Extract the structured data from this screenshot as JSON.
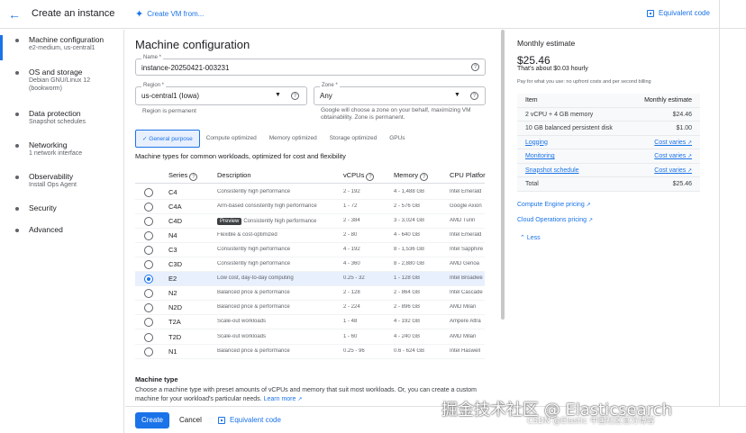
{
  "header": {
    "title": "Create an instance",
    "create_vm_from": "Create VM from...",
    "equivalent_code": "Equivalent code"
  },
  "nav": [
    {
      "label": "Machine configuration",
      "sub": "e2-medium, us-central1",
      "active": true
    },
    {
      "label": "OS and storage",
      "sub": "Debian GNU/Linux 12 (bookworm)"
    },
    {
      "label": "Data protection",
      "sub": "Snapshot schedules"
    },
    {
      "label": "Networking",
      "sub": "1 network interface"
    },
    {
      "label": "Observability",
      "sub": "Install Ops Agent"
    },
    {
      "label": "Security",
      "sub": ""
    },
    {
      "label": "Advanced",
      "sub": ""
    }
  ],
  "main": {
    "title": "Machine configuration",
    "name_label": "Name *",
    "name_value": "instance-20250421-003231",
    "region_label": "Region *",
    "region_value": "us-central1 (Iowa)",
    "region_hint": "Region is permanent",
    "zone_label": "Zone *",
    "zone_value": "Any",
    "zone_hint": "Google will choose a zone on your behalf, maximizing VM obtainability. Zone is permanent.",
    "tabs": [
      "General purpose",
      "Compute optimized",
      "Memory optimized",
      "Storage optimized",
      "GPUs"
    ],
    "machine_types_title": "Machine types for common workloads, optimized for cost and flexibility",
    "columns": [
      "Series",
      "Description",
      "vCPUs",
      "Memory",
      "CPU Platfor"
    ],
    "rows": [
      {
        "series": "C4",
        "desc": "Consistently high performance",
        "vcpus": "2 - 192",
        "memory": "4 - 1,488 GB",
        "platform": "Intel Emerald"
      },
      {
        "series": "C4A",
        "desc": "Arm-based consistently high performance",
        "vcpus": "1 - 72",
        "memory": "2 - 576 GB",
        "platform": "Google Axion"
      },
      {
        "series": "C4D",
        "desc": "Consistently high performance",
        "preview": "Preview",
        "vcpus": "2 - 384",
        "memory": "3 - 3,024 GB",
        "platform": "AMD Turin"
      },
      {
        "series": "N4",
        "desc": "Flexible & cost-optimized",
        "vcpus": "2 - 80",
        "memory": "4 - 640 GB",
        "platform": "Intel Emerald"
      },
      {
        "series": "C3",
        "desc": "Consistently high performance",
        "vcpus": "4 - 192",
        "memory": "8 - 1,536 GB",
        "platform": "Intel Sapphire"
      },
      {
        "series": "C3D",
        "desc": "Consistently high performance",
        "vcpus": "4 - 360",
        "memory": "8 - 2,880 GB",
        "platform": "AMD Genoa"
      },
      {
        "series": "E2",
        "desc": "Low cost, day-to-day computing",
        "vcpus": "0.25 - 32",
        "memory": "1 - 128 GB",
        "platform": "Intel Broadwe",
        "selected": true
      },
      {
        "series": "N2",
        "desc": "Balanced price & performance",
        "vcpus": "2 - 128",
        "memory": "2 - 864 GB",
        "platform": "Intel Cascade"
      },
      {
        "series": "N2D",
        "desc": "Balanced price & performance",
        "vcpus": "2 - 224",
        "memory": "2 - 896 GB",
        "platform": "AMD Milan"
      },
      {
        "series": "T2A",
        "desc": "Scale-out workloads",
        "vcpus": "1 - 48",
        "memory": "4 - 192 GB",
        "platform": "Ampere Altra"
      },
      {
        "series": "T2D",
        "desc": "Scale-out workloads",
        "vcpus": "1 - 60",
        "memory": "4 - 240 GB",
        "platform": "AMD Milan"
      },
      {
        "series": "N1",
        "desc": "Balanced price & performance",
        "vcpus": "0.25 - 96",
        "memory": "0.6 - 624 GB",
        "platform": "Intel Haswell"
      }
    ],
    "machine_type_heading": "Machine type",
    "machine_type_desc": "Choose a machine type with preset amounts of vCPUs and memory that suit most workloads. Or, you can create a custom machine for your workload's particular needs.",
    "learn_more": "Learn more"
  },
  "footer": {
    "create": "Create",
    "cancel": "Cancel",
    "equivalent_code": "Equivalent code"
  },
  "estimate": {
    "title": "Monthly estimate",
    "price": "$25.46",
    "hourly": "That's about $0.03 hourly",
    "note": "Pay for what you use: no upfront costs and per second billing",
    "head_item": "Item",
    "head_estimate": "Monthly estimate",
    "rows": [
      {
        "item": "2 vCPU + 4 GB memory",
        "value": "$24.46"
      },
      {
        "item": "10 GB balanced persistent disk",
        "value": "$1.00"
      },
      {
        "item": "Logging",
        "value": "Cost varies",
        "link": true
      },
      {
        "item": "Monitoring",
        "value": "Cost varies",
        "link": true
      },
      {
        "item": "Snapshot schedule",
        "value": "Cost varies",
        "link": true
      },
      {
        "item": "Total",
        "value": "$25.46"
      }
    ],
    "compute_pricing": "Compute Engine pricing",
    "ops_pricing": "Cloud Operations pricing",
    "less": "Less"
  },
  "watermark": {
    "line1": "掘金技术社区 @ Elasticsearch",
    "line2": "CSDN @Elastic 中国社区官方博客"
  },
  "colors": {
    "accent": "#1a73e8",
    "selected_row": "#e8f0fe"
  }
}
